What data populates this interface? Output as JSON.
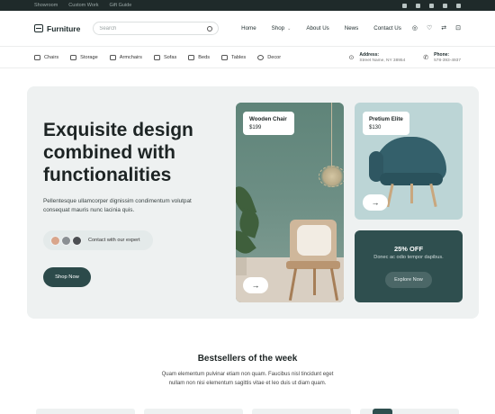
{
  "topbar": {
    "links": [
      "Showroom",
      "Custom Work",
      "Gift Guide"
    ],
    "socials": [
      "facebook-icon",
      "twitter-icon",
      "instagram-icon",
      "linkedin-icon",
      "youtube-icon"
    ]
  },
  "header": {
    "logo": "Furniture",
    "search_placeholder": "Search",
    "nav": [
      {
        "label": "Home"
      },
      {
        "label": "Shop",
        "has_dropdown": true
      },
      {
        "label": "About Us"
      },
      {
        "label": "News"
      },
      {
        "label": "Contact Us"
      }
    ],
    "icons": [
      "user-icon",
      "heart-icon",
      "compare-icon",
      "cart-icon"
    ]
  },
  "categories": {
    "items": [
      {
        "label": "Chairs",
        "icon": "chair-icon"
      },
      {
        "label": "Storage",
        "icon": "storage-icon"
      },
      {
        "label": "Armchairs",
        "icon": "armchair-icon"
      },
      {
        "label": "Sofas",
        "icon": "sofa-icon"
      },
      {
        "label": "Beds",
        "icon": "bed-icon"
      },
      {
        "label": "Tables",
        "icon": "table-icon"
      },
      {
        "label": "Decor",
        "icon": "decor-icon"
      }
    ],
    "address_label": "Address:",
    "address_value": "Street Name, NY 38954",
    "phone_label": "Phone:",
    "phone_value": "578-393-4937"
  },
  "hero": {
    "title": "Exquisite design combined with functionalities",
    "description": "Pellentesque ullamcorper dignissim condimentum volutpat consequat mauris nunc lacinia quis.",
    "expert_text": "Contact with our expert",
    "shop_button": "Shop Now",
    "accent_color": "#2c4a4a"
  },
  "products": {
    "wooden_chair": {
      "name": "Wooden Chair",
      "price": "$199"
    },
    "pretium_elite": {
      "name": "Pretium Elite",
      "price": "$130"
    }
  },
  "promo": {
    "headline": "25% OFF",
    "text": "Donec ac odio tempor dapibus.",
    "button": "Explore Now"
  },
  "bestsellers": {
    "title": "Bestsellers of the week",
    "description": "Quam elementum pulvinar etiam non quam. Faucibus nisl tincidunt eget nullam non nisi elementum sagittis vitae et leo duis ut diam quam."
  }
}
